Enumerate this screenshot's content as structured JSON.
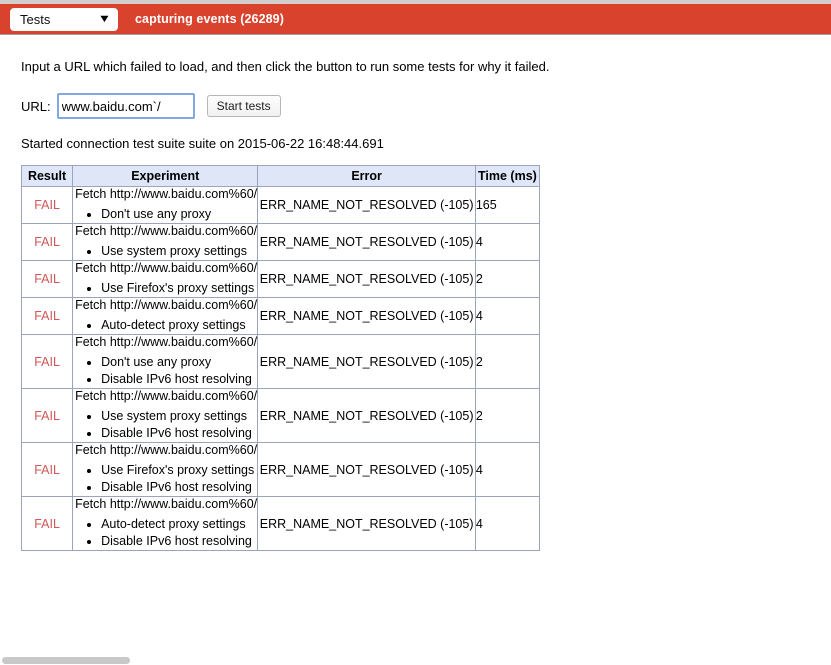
{
  "toolbar": {
    "view_selector_label": "Tests",
    "view_selector_caret": "▼",
    "capture_status": "capturing events (26289)",
    "accent_color": "#d9422d"
  },
  "page": {
    "intro": "Input a URL which failed to load, and then click the button to run some tests for why it failed.",
    "url_label": "URL:",
    "url_value": "www.baidu.com`/",
    "url_placeholder": "",
    "start_button": "Start tests",
    "started_line": "Started connection test suite suite on 2015-06-22 16:48:44.691"
  },
  "table": {
    "headers": [
      "Result",
      "Experiment",
      "Error",
      "Time (ms)"
    ],
    "rows": [
      {
        "result": "FAIL",
        "fetch": "Fetch http://www.baidu.com%60/",
        "options": [
          "Don't use any proxy"
        ],
        "error": "ERR_NAME_NOT_RESOLVED (-105)",
        "time": "165"
      },
      {
        "result": "FAIL",
        "fetch": "Fetch http://www.baidu.com%60/",
        "options": [
          "Use system proxy settings"
        ],
        "error": "ERR_NAME_NOT_RESOLVED (-105)",
        "time": "4"
      },
      {
        "result": "FAIL",
        "fetch": "Fetch http://www.baidu.com%60/",
        "options": [
          "Use Firefox's proxy settings"
        ],
        "error": "ERR_NAME_NOT_RESOLVED (-105)",
        "time": "2"
      },
      {
        "result": "FAIL",
        "fetch": "Fetch http://www.baidu.com%60/",
        "options": [
          "Auto-detect proxy settings"
        ],
        "error": "ERR_NAME_NOT_RESOLVED (-105)",
        "time": "4"
      },
      {
        "result": "FAIL",
        "fetch": "Fetch http://www.baidu.com%60/",
        "options": [
          "Don't use any proxy",
          "Disable IPv6 host resolving"
        ],
        "error": "ERR_NAME_NOT_RESOLVED (-105)",
        "time": "2"
      },
      {
        "result": "FAIL",
        "fetch": "Fetch http://www.baidu.com%60/",
        "options": [
          "Use system proxy settings",
          "Disable IPv6 host resolving"
        ],
        "error": "ERR_NAME_NOT_RESOLVED (-105)",
        "time": "2"
      },
      {
        "result": "FAIL",
        "fetch": "Fetch http://www.baidu.com%60/",
        "options": [
          "Use Firefox's proxy settings",
          "Disable IPv6 host resolving"
        ],
        "error": "ERR_NAME_NOT_RESOLVED (-105)",
        "time": "4"
      },
      {
        "result": "FAIL",
        "fetch": "Fetch http://www.baidu.com%60/",
        "options": [
          "Auto-detect proxy settings",
          "Disable IPv6 host resolving"
        ],
        "error": "ERR_NAME_NOT_RESOLVED (-105)",
        "time": "4"
      }
    ]
  }
}
